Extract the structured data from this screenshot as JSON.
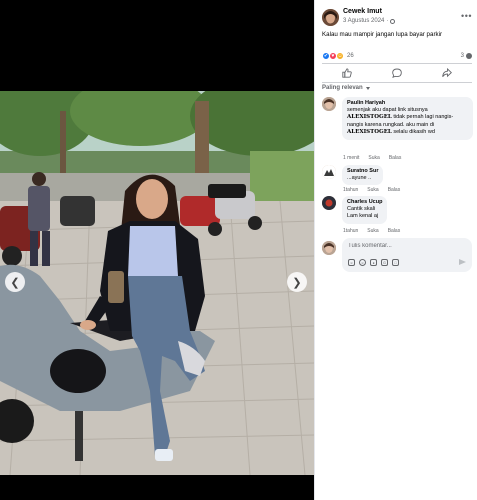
{
  "post": {
    "author": "Cewek Imut",
    "date": "3 Agustus 2024",
    "date_separator": "·",
    "caption": "Kalau mau mampir jangan lupa bayar parkir",
    "reaction_count": "26",
    "comment_count": "3"
  },
  "media": {
    "prev_icon": "chevron-left-icon",
    "next_icon": "chevron-right-icon"
  },
  "actions": {
    "like_icon": "thumbs-up-icon",
    "comment_icon": "comment-icon",
    "share_icon": "share-icon"
  },
  "comments_sort": "Paling relevan",
  "comments": [
    {
      "name": "Paulin Hariyah",
      "text_before": "semenjak aku dapat link situsnya",
      "brand_1": "ALEXISTOGEL",
      "text_middle": "tidak pernah lagi nangis-nangis karena rungkad. aku main di",
      "brand_2": "ALEXISTOGEL",
      "text_after": "selalu dikasih wd",
      "time": "1 menit",
      "like": "Suka",
      "reply": "Balas"
    },
    {
      "name": "Suratno Sur",
      "text": "...ayune ..",
      "time": "1tahun",
      "like": "Suka",
      "reply": "Balas"
    },
    {
      "name": "Charles Ucup",
      "text_line1": "Cantik skali",
      "text_line2": "Lam kenal aj",
      "time": "1tahun",
      "like": "Suka",
      "reply": "Balas"
    }
  ],
  "compose": {
    "placeholder": "Tulis komentar..."
  },
  "colors": {
    "accent": "#1877f2",
    "love": "#f33e58",
    "haha": "#f7b125",
    "bubble": "#f0f2f5",
    "meta_text": "#65676b"
  }
}
